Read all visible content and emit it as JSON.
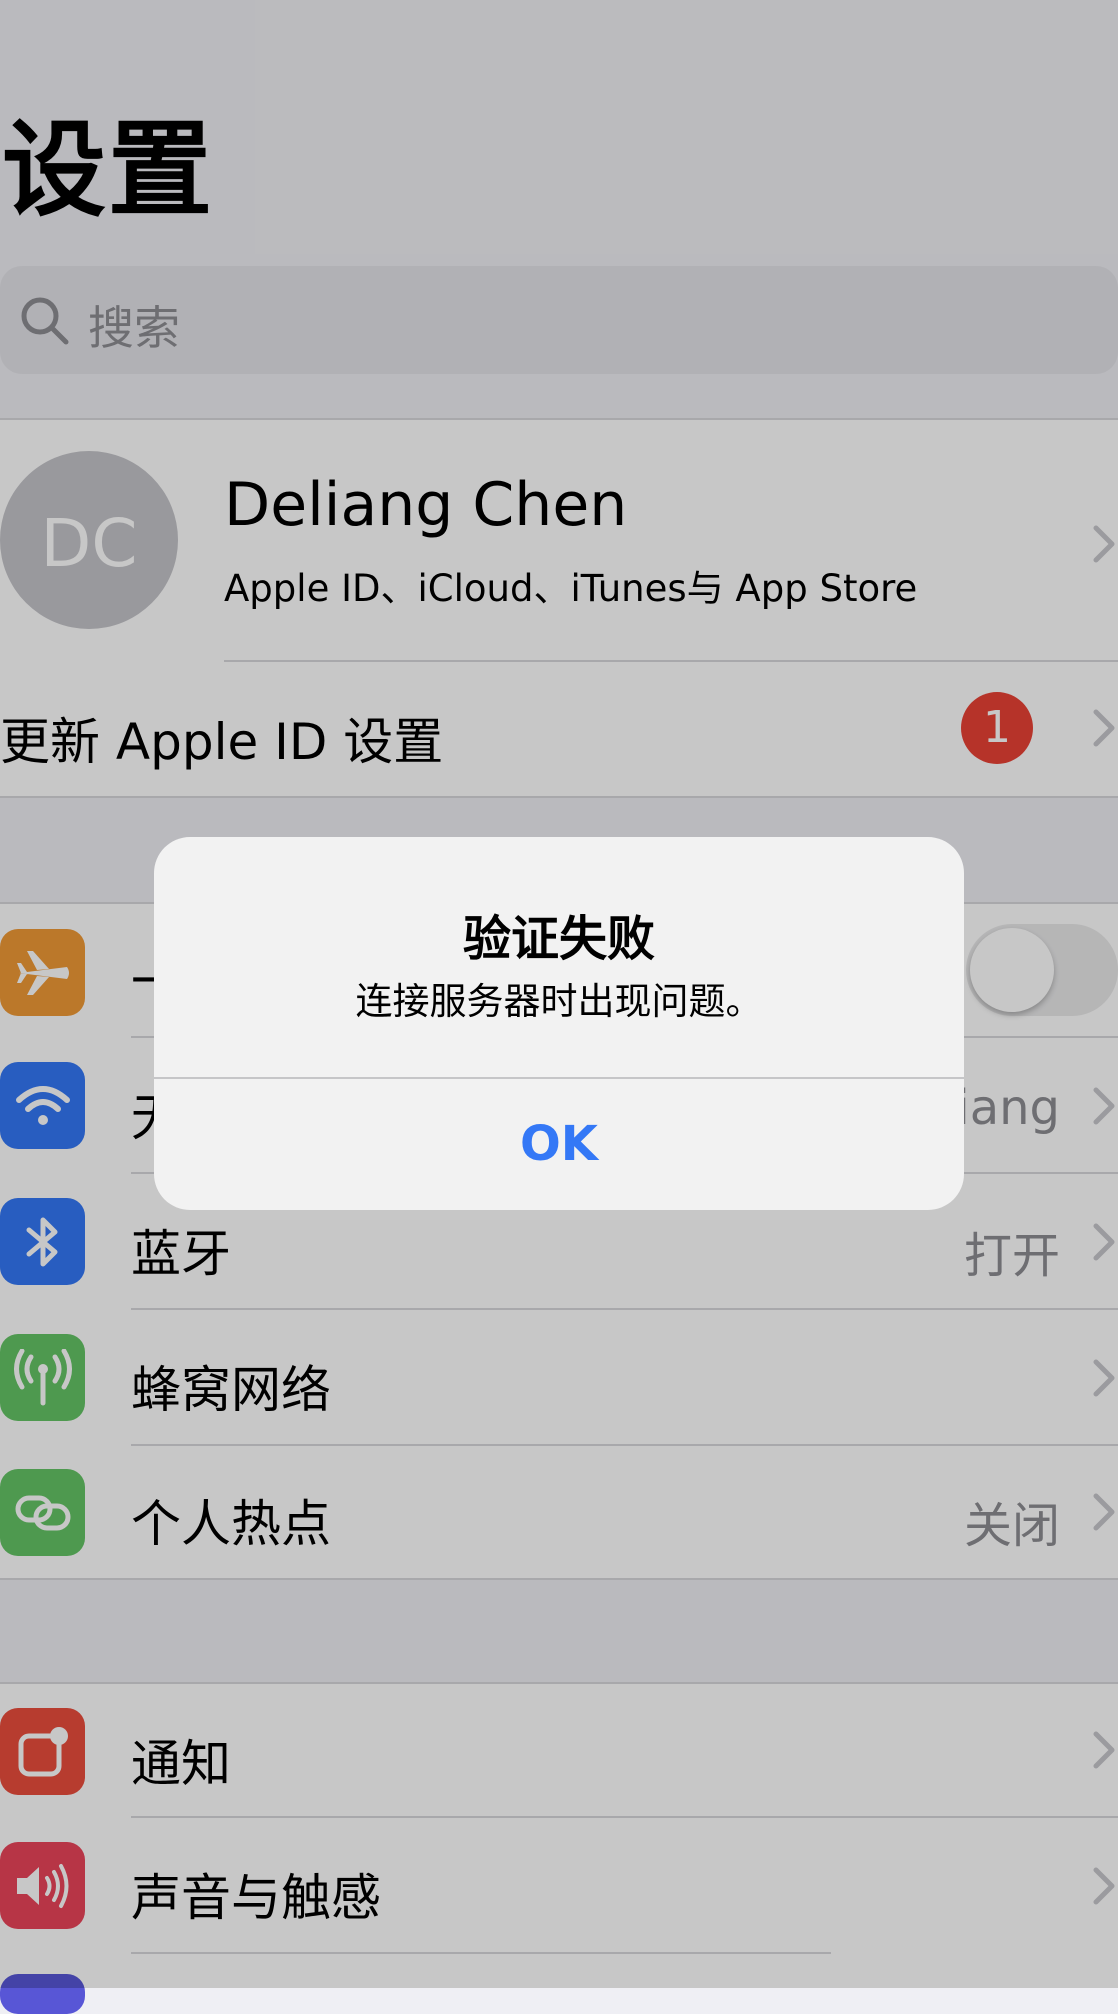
{
  "page": {
    "title": "设置"
  },
  "search": {
    "placeholder": "搜索"
  },
  "profile": {
    "initials": "DC",
    "name": "Deliang Chen",
    "subtitle": "Apple ID、iCloud、iTunes与 App Store"
  },
  "update_row": {
    "label": "更新 Apple ID 设置",
    "badge": "1"
  },
  "settings": {
    "airplane": {
      "label": "一",
      "toggle_on": false
    },
    "wifi": {
      "label": "无",
      "value": "iang"
    },
    "bluetooth": {
      "label": "蓝牙",
      "value": "打开"
    },
    "cellular": {
      "label": "蜂窝网络"
    },
    "hotspot": {
      "label": "个人热点",
      "value": "关闭"
    },
    "notifications": {
      "label": "通知"
    },
    "sounds": {
      "label": "声音与触感"
    }
  },
  "alert": {
    "title": "验证失败",
    "message": "连接服务器时出现问题。",
    "ok_label": "OK"
  },
  "colors": {
    "airplane": "#f09a37",
    "wifi": "#3478f6",
    "bluetooth": "#3478f6",
    "cellular": "#65c466",
    "hotspot": "#65c466",
    "notifications": "#eb4d3d",
    "sounds": "#eb445a",
    "badge": "#e94235",
    "accent": "#3478f6"
  }
}
